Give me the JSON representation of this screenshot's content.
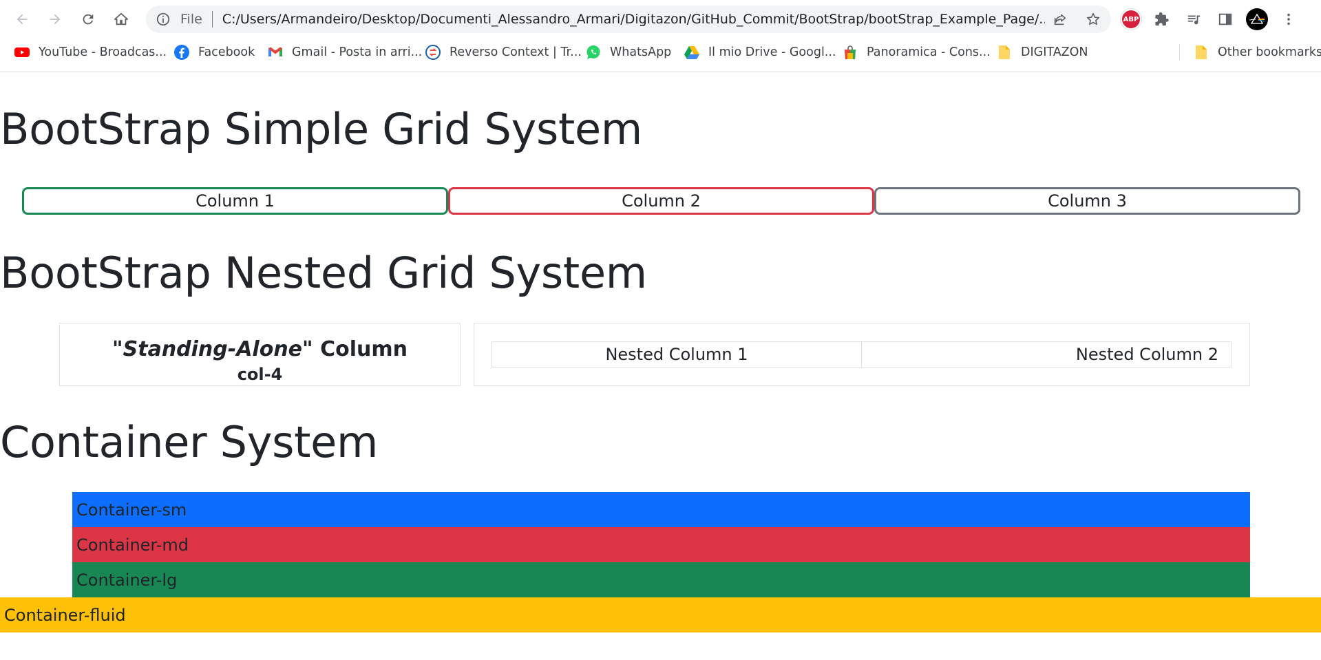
{
  "browser": {
    "file_label": "File",
    "url": "C:/Users/Armandeiro/Desktop/Documenti_Alessandro_Armari/Digitazon/GitHub_Commit/BootStrap/bootStrap_Example_Page/...",
    "extensions": {
      "abp_label": "ABP"
    },
    "bookmarks": [
      {
        "label": "YouTube - Broadcas...",
        "icon": "youtube-icon"
      },
      {
        "label": "Facebook",
        "icon": "facebook-icon"
      },
      {
        "label": "Gmail - Posta in arri...",
        "icon": "gmail-icon"
      },
      {
        "label": "Reverso Context | Tr...",
        "icon": "reverso-icon"
      },
      {
        "label": "WhatsApp",
        "icon": "whatsapp-icon"
      },
      {
        "label": "Il mio Drive - Googl...",
        "icon": "google-drive-icon"
      },
      {
        "label": "Panoramica - Cons...",
        "icon": "shopping-bag-icon"
      },
      {
        "label": "DIGITAZON",
        "icon": "folder-icon"
      }
    ],
    "other_bookmarks": "Other bookmarks"
  },
  "page": {
    "simple_grid": {
      "title": "BootStrap Simple Grid System",
      "columns": [
        "Column 1",
        "Column 2",
        "Column 3"
      ],
      "border_colors": [
        "#198754",
        "#dc3545",
        "#6c757d"
      ]
    },
    "nested_grid": {
      "title": "BootStrap Nested Grid System",
      "standing_quote_open": "\"",
      "standing_italic": "Standing-Alone",
      "standing_rest": "\" Column",
      "standing_sub": "col-4",
      "nested_columns": [
        "Nested Column 1",
        "Nested Column 2"
      ]
    },
    "container_system": {
      "title": "Container System",
      "containers": [
        {
          "label": "Container-sm",
          "color": "#0d6efd"
        },
        {
          "label": "Container-md",
          "color": "#dc3545"
        },
        {
          "label": "Container-lg",
          "color": "#198754"
        },
        {
          "label": "Container-fluid",
          "color": "#ffc107"
        }
      ]
    }
  }
}
